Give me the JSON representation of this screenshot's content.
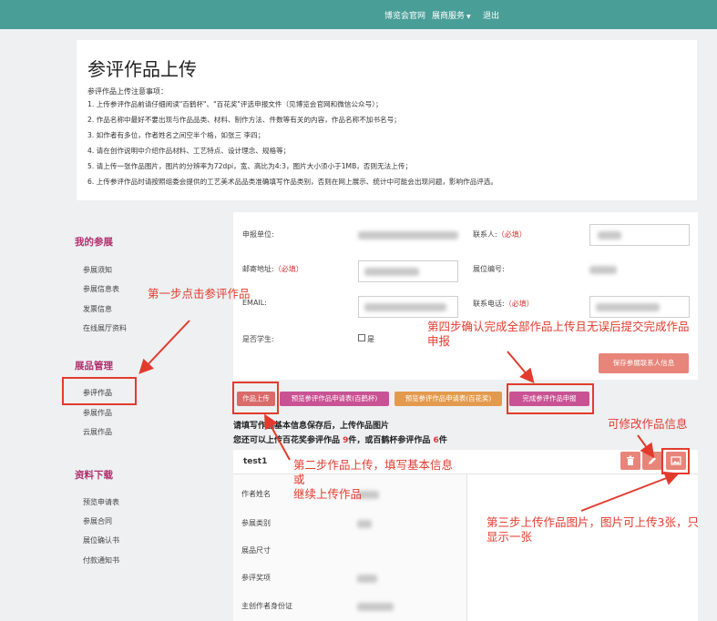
{
  "topnav": {
    "links": [
      "博览会官网",
      "展商服务",
      "退出"
    ]
  },
  "intro": {
    "title": "参评作品上传",
    "notes_title": "参评作品上传注意事项：",
    "notes": [
      "1. 上传参评作品前请仔细阅读\"百鹤杯\"、\"百花奖\"评选申报文件（见博览会官网和微信公众号）；",
      "2. 作品名称中最好不要出现与作品品类、材料、制作方法、件数等有关的内容，作品名称不加书名号；",
      "3. 如作者有多位，作者姓名之间空半个格，如张三 李四；",
      "4. 请在创作说明中介绍作品材料、工艺特点、设计理念、规格等；",
      "5. 请上传一张作品图片，图片的分辨率为72dpi，宽、高比为4:3，图片大小须小于1MB，否则无法上传；",
      "6. 上传参评作品时请按照组委会提供的工艺美术品品类准确填写作品类别，否则在网上展示、统计中可能会出现问题，影响作品评选。"
    ]
  },
  "sidebar": {
    "groups": [
      {
        "title": "我的参展",
        "items": [
          "参展须知",
          "参展信息表",
          "发票信息",
          "在线展厅资料"
        ]
      },
      {
        "title": "展品管理",
        "items": [
          "参评作品",
          "参展作品",
          "云展作品"
        ]
      },
      {
        "title": "资料下载",
        "items": [
          "预览申请表",
          "参展合同",
          "展位确认书",
          "付款通知书"
        ]
      }
    ]
  },
  "form": {
    "unit_label": "申报单位:",
    "contact_label": "联系人:",
    "address_label": "邮寄地址:",
    "booth_label": "展位编号:",
    "email_label": "EMAIL:",
    "phone_label": "联系电话:",
    "student_label": "是否学生:",
    "student_option": "是",
    "required": "（必填）",
    "save_button": "保存参展联系人信息"
  },
  "actions": {
    "upload": "作品上传",
    "preview_baihe": "预览参评作品申请表(百鹤杯)",
    "preview_baihua": "预览参评作品申请表(百花奖)",
    "finish": "完成参评作品申报"
  },
  "hints": {
    "line1": "请填写作品基本信息保存后，上传作品图片",
    "line2_prefix": "您还可以上传百花奖参评作品 ",
    "line2_num1": "9",
    "line2_mid": "件，或百鹤杯参评作品 ",
    "line2_num2": "6",
    "line2_suffix": "件"
  },
  "work": {
    "title": "test1",
    "fields": [
      "作者姓名",
      "参展类别",
      "展品尺寸",
      "参评奖项",
      "主创作者身份证"
    ]
  },
  "annotations": {
    "step1": "第一步点击参评作品",
    "step2": "第二步作品上传，填写基本信息\n或\n继续上传作品",
    "step3": "第三步上传作品图片，图片可上传3张，只\n显示一张",
    "step4": "第四步确认完成全部作品上传且无误后提交完成作品\n申报",
    "edit": "可修改作品信息"
  },
  "colors": {
    "nav": "#4a9e98",
    "accent_magenta": "#c85293",
    "accent_orange": "#e49a4e",
    "annotation_red": "#e23b2e"
  }
}
